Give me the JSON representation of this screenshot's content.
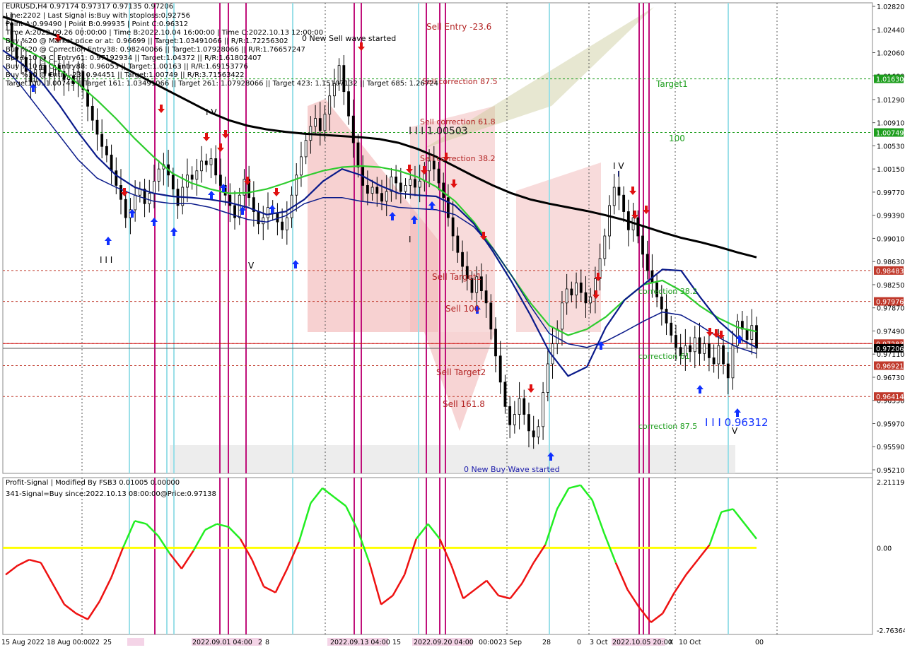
{
  "header": {
    "symbol_line": "EURUSD,H4  0.97174 0.97317 0.97135 0.97206",
    "info_lines": [
      "Line:2202 | Last Signal is:Buy with stoploss:0.92756",
      "Point A:0.99490 | Point B:0.99935 | Point C:0.96312",
      "Time A:2022.09.26 00:00:00 | Time B:2022.10.04 16:00:00 | Time C:2022.10.13 12:00:00",
      "Buy %20 @ Market price or at: 0.96699 || Target:1.03491066 || R/R:1.72256302",
      "Buy %20 @ Correction Entry38: 0.98240066 || Target:1.07928066 || R/R:1.76657247",
      "Buy %10 @ C_Entry61: 0.97192934 || Target:1.04372 || R/R:1.61802407",
      "Buy %10 @ C_Entry88: 0.96053 || Target:1.00163 || R/R:1.69153776",
      "Buy %10 @ Entry -23: 0.94451 || Target:1.00749 || R/R:3.71563422",
      "Target100: 1.00749 || Target 161: 1.03491066 || Target 261: 1.07928066 || Target 423: 1.15107132 || Target 685: 1.26724"
    ]
  },
  "indicator": {
    "title": "Profit-Signal | Modified By FSB3 0.01005 0.00000",
    "signal": "341-Signal=Buy since:2022.10.13 08:00:00@Price:0.97138"
  },
  "price_axis": {
    "ticks": [
      "1.02820",
      "1.02440",
      "1.02060",
      "1.01680",
      "1.01290",
      "1.00910",
      "1.00530",
      "1.00150",
      "0.99770",
      "0.99390",
      "0.99010",
      "0.98630",
      "0.98250",
      "0.97870",
      "0.97490",
      "0.97110",
      "0.96730",
      "0.96350",
      "0.95970",
      "0.95590",
      "0.95210"
    ],
    "badges": [
      {
        "label": "1.01630",
        "color": "#1e9e1e"
      },
      {
        "label": "1.00749",
        "color": "#1e9e1e"
      },
      {
        "label": "0.98483",
        "color": "#c0392b"
      },
      {
        "label": "0.97976",
        "color": "#c0392b"
      },
      {
        "label": "0.97283",
        "color": "#c0392b"
      },
      {
        "label": "0.97206",
        "color": "#000000"
      },
      {
        "label": "0.96921",
        "color": "#c0392b"
      },
      {
        "label": "0.96414",
        "color": "#c0392b"
      }
    ]
  },
  "indicator_axis": {
    "ticks": [
      "2.21119",
      "0.00",
      "-2.76364"
    ]
  },
  "time_axis": {
    "labels": [
      "15 Aug 2022",
      "18 Aug 00:00",
      "22",
      "25",
      "2022.09.01 04:00",
      "2",
      "8",
      "2022.09.13 04:00",
      "15",
      "2022.09.20 04:00",
      "00:00",
      "23 Sep",
      "28",
      "0",
      "3 Oct",
      "2022.10.05 20:00",
      "X",
      "10 Oct",
      "00"
    ]
  },
  "chart_labels": {
    "new_sell_wave": "0 New Sell wave started",
    "new_buy_wave": "0 New Buy Wave started",
    "sell_entry": "Sell Entry -23.6",
    "sell_corr_875": "Sell correction 87.5",
    "sell_corr_618": "Sell correction 61.8",
    "sell_corr_382": "Sell correction 38.2",
    "sell_target1": "Sell Target1",
    "sell_100": "Sell 100",
    "sell_target2": "Sell Target2",
    "sell_1618": "Sell 161.8",
    "target1": "Target1",
    "level_100": "100",
    "correction_382": "correction 38.2",
    "correction_61": "correction 61",
    "correction_875": "correction 87.5",
    "iii_100503": "I I I 1.00503",
    "iii_096312": "I I I 0.96312",
    "wave_iv_1": "I V",
    "wave_iv_2": "I V",
    "wave_iii": "I I I",
    "wave_v_1": "V",
    "wave_v_2": "V",
    "wave_i_1": "I",
    "wave_i_2": "I"
  },
  "colors": {
    "up_arrow": "#1030ff",
    "down_arrow": "#e01010",
    "green_level": "#1e9e1e",
    "red_level": "#c0392b",
    "magenta_vline": "#c0107a",
    "cyan_vline": "#9adfe8",
    "ma_black": "#000000",
    "ma_navy": "#0a1a8a",
    "ma_green": "#2ecc2e",
    "indicator_up": "#22ee22",
    "indicator_down": "#ee1111",
    "indicator_zero": "#ffff00"
  },
  "chart_data": {
    "type": "candlestick",
    "symbol": "EURUSD",
    "timeframe": "H4",
    "ohlc_last": {
      "open": 0.97174,
      "high": 0.97317,
      "low": 0.97135,
      "close": 0.97206
    },
    "ylim": [
      0.9521,
      1.0282
    ],
    "indicator_ylim": [
      -2.76364,
      2.21119
    ],
    "horizontal_levels": [
      {
        "value": 1.0163,
        "color": "green"
      },
      {
        "value": 1.00749,
        "color": "green"
      },
      {
        "value": 0.98483,
        "color": "red"
      },
      {
        "value": 0.97976,
        "color": "red"
      },
      {
        "value": 0.97283,
        "color": "red"
      },
      {
        "value": 0.97206,
        "color": "current"
      },
      {
        "value": 0.96921,
        "color": "red"
      },
      {
        "value": 0.96414,
        "color": "red"
      }
    ],
    "close_path": [
      1.0255,
      1.0215,
      1.0195,
      1.0198,
      1.0175,
      1.0158,
      1.0178,
      1.0185,
      1.0172,
      1.0168,
      1.0185,
      1.0175,
      1.0162,
      1.0168,
      1.0155,
      1.0175,
      1.0145,
      1.0118,
      1.0095,
      1.0072,
      1.0052,
      1.0038,
      1.0012,
      0.9988,
      0.9965,
      0.9935,
      0.9948,
      0.9972,
      0.9982,
      0.9958,
      0.9975,
      0.9995,
      1.0015,
      1.0022,
      1.0005,
      0.9982,
      0.9955,
      0.9985,
      1.0005,
      0.9998,
      1.0012,
      1.0028,
      1.0022,
      1.0032,
      1.0005,
      0.9988,
      0.9972,
      0.9955,
      0.9935,
      0.9972,
      0.9998,
      0.9968,
      0.9945,
      0.9925,
      0.9935,
      0.9952,
      0.9942,
      0.9928,
      0.9915,
      0.9935,
      0.9972,
      1.0005,
      1.0035,
      1.0062,
      1.0085,
      1.0098,
      1.0078,
      1.0105,
      1.0135,
      1.0155,
      1.0185,
      1.0142,
      1.0102,
      1.0058,
      1.0018,
      0.9988,
      0.9975,
      0.9985,
      0.9975,
      0.9962,
      0.9978,
      1.0002,
      0.9992,
      0.9978,
      0.9988,
      0.9998,
      0.9985,
      0.9995,
      1.0012,
      1.0028,
      1.0015,
      0.9992,
      0.9968,
      0.9935,
      0.9905,
      0.9878,
      0.9855,
      0.9835,
      0.9812,
      0.9838,
      0.9815,
      0.9795,
      0.9752,
      0.9708,
      0.9665,
      0.9625,
      0.9595,
      0.9612,
      0.9638,
      0.9612,
      0.9585,
      0.9575,
      0.9592,
      0.9648,
      0.9695,
      0.9728,
      0.9752,
      0.9795,
      0.9818,
      0.9808,
      0.9828,
      0.9812,
      0.9795,
      0.9805,
      0.9835,
      0.9868,
      0.9905,
      0.9955,
      0.9985,
      0.9972,
      0.9945,
      0.9915,
      0.9935,
      0.9905,
      0.9875,
      0.9848,
      0.9828,
      0.9805,
      0.9785,
      0.9762,
      0.9742,
      0.9722,
      0.9708,
      0.9725,
      0.9715,
      0.9738,
      0.9712,
      0.9728,
      0.9705,
      0.9695,
      0.9725,
      0.9695,
      0.9672,
      0.9725,
      0.9765,
      0.9752,
      0.9735,
      0.9758,
      0.9721
    ],
    "moving_averages": [
      {
        "color": "black",
        "values": [
          1.0265,
          1.0255,
          1.0244,
          1.0232,
          1.0218,
          1.0203,
          1.0188,
          1.0172,
          1.0156,
          1.014,
          1.0124,
          1.0108,
          1.0095,
          1.0086,
          1.008,
          1.0076,
          1.0073,
          1.0071,
          1.0069,
          1.0067,
          1.0064,
          1.0058,
          1.0048,
          1.0035,
          1.0019,
          1.0003,
          0.9988,
          0.9975,
          0.9965,
          0.9958,
          0.9952,
          0.9946,
          0.9939,
          0.9931,
          0.9921,
          0.9911,
          0.9902,
          0.9895,
          0.9887,
          0.9878,
          0.987
        ]
      },
      {
        "color": "green",
        "values": [
          1.023,
          1.0215,
          1.0198,
          1.0178,
          1.0155,
          1.0128,
          1.0098,
          1.0065,
          1.0035,
          1.0008,
          0.9992,
          0.9982,
          0.9975,
          0.9976,
          0.9982,
          0.9992,
          1.0003,
          1.0012,
          1.0018,
          1.002,
          1.0018,
          1.0012,
          1.0002,
          0.9986,
          0.9962,
          0.9928,
          0.9885,
          0.984,
          0.9795,
          0.9758,
          0.9742,
          0.9752,
          0.9772,
          0.98,
          0.9825,
          0.9832,
          0.9815,
          0.979,
          0.977,
          0.9755,
          0.9748
        ]
      },
      {
        "color": "navy",
        "values": [
          1.021,
          1.0188,
          1.016,
          1.012,
          1.0075,
          1.0035,
          1.0005,
          0.9985,
          0.9975,
          0.997,
          0.9968,
          0.9965,
          0.996,
          0.9952,
          0.994,
          0.9945,
          0.9965,
          0.9995,
          1.0015,
          1.0005,
          0.9988,
          0.9975,
          0.9972,
          0.997,
          0.9955,
          0.9925,
          0.988,
          0.983,
          0.9775,
          0.9715,
          0.9675,
          0.969,
          0.9755,
          0.98,
          0.9825,
          0.985,
          0.9848,
          0.9805,
          0.9765,
          0.9738,
          0.9722
        ]
      }
    ],
    "indicator_series": {
      "name": "Profit-Signal",
      "values": [
        -0.9,
        -0.6,
        -0.4,
        -0.5,
        -1.2,
        -1.9,
        -2.2,
        -2.4,
        -1.8,
        -1.0,
        0.0,
        0.9,
        0.8,
        0.4,
        -0.2,
        -0.7,
        -0.1,
        0.6,
        0.8,
        0.7,
        0.3,
        -0.4,
        -1.3,
        -1.5,
        -0.7,
        0.2,
        1.5,
        2.0,
        1.7,
        1.4,
        0.6,
        -0.5,
        -1.9,
        -1.6,
        -0.9,
        0.3,
        0.8,
        0.3,
        -0.6,
        -1.7,
        -1.4,
        -1.1,
        -1.6,
        -1.7,
        -1.2,
        -0.5,
        0.1,
        1.3,
        2.0,
        2.1,
        1.6,
        0.5,
        -0.5,
        -1.4,
        -2.0,
        -2.5,
        -2.2,
        -1.5,
        -0.9,
        -0.4,
        0.1,
        1.2,
        1.3,
        0.8,
        0.3
      ]
    }
  }
}
